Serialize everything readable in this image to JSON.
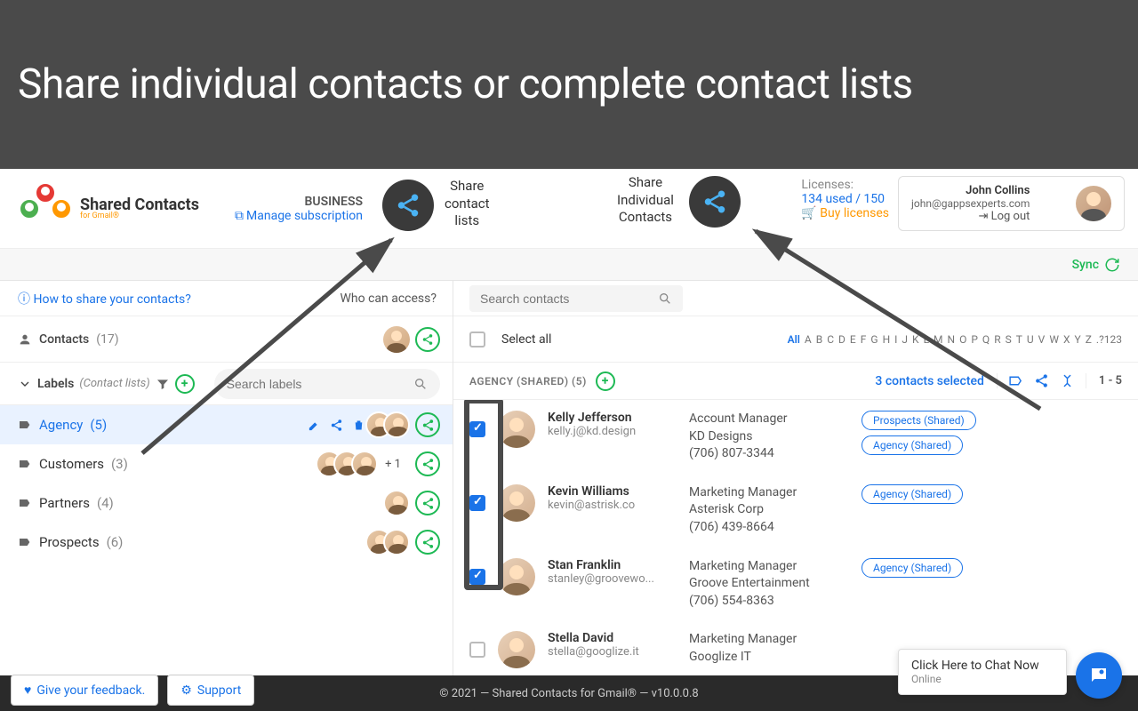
{
  "banner": {
    "title": "Share individual contacts or complete contact lists"
  },
  "logo": {
    "name": "Shared Contacts",
    "sub": "for Gmail®"
  },
  "plan": {
    "name": "BUSINESS",
    "manage": "Manage subscription"
  },
  "bubbles": {
    "lists": "Share\ncontact\nlists",
    "individual": "Share\nIndividual\nContacts"
  },
  "licenses": {
    "title": "Licenses:",
    "used": "134 used / 150",
    "buy": "Buy licenses"
  },
  "user": {
    "name": "John Collins",
    "email": "john@gappsexperts.com",
    "logout": "Log out"
  },
  "sync": "Sync",
  "sidebar": {
    "howto": "How to share your contacts?",
    "who": "Who can access?",
    "contacts": "Contacts",
    "contacts_count": "(17)",
    "labels_head": "Labels",
    "labels_sub": "(Contact lists)",
    "search_ph": "Search labels",
    "items": [
      {
        "name": "Agency",
        "count": "(5)",
        "active": true,
        "avatars": 2
      },
      {
        "name": "Customers",
        "count": "(3)",
        "active": false,
        "avatars": 3,
        "plus": "+ 1"
      },
      {
        "name": "Partners",
        "count": "(4)",
        "active": false,
        "avatars": 1
      },
      {
        "name": "Prospects",
        "count": "(6)",
        "active": false,
        "avatars": 2
      }
    ]
  },
  "content": {
    "search_ph": "Search contacts",
    "select_all": "Select all",
    "alpha_active": "All",
    "alpha": [
      "A",
      "B",
      "C",
      "D",
      "E",
      "F",
      "G",
      "H",
      "I",
      "J",
      "K",
      "L",
      "M",
      "N",
      "O",
      "P",
      "Q",
      "R",
      "S",
      "T",
      "U",
      "V",
      "W",
      "X",
      "Y",
      "Z",
      ".?123"
    ],
    "header_title": "AGENCY (SHARED) (5)",
    "selected": "3 contacts selected",
    "pager": "1 - 5",
    "rows": [
      {
        "name": "Kelly Jefferson",
        "email": "kelly.j@kd.design",
        "title": "Account Manager",
        "company": "KD Designs",
        "phone": "(706) 807-3344",
        "tags": [
          "Prospects (Shared)",
          "Agency (Shared)"
        ],
        "checked": true
      },
      {
        "name": "Kevin Williams",
        "email": "kevin@astrisk.co",
        "title": "Marketing Manager",
        "company": "Asterisk Corp",
        "phone": "(706) 439-8664",
        "tags": [
          "Agency (Shared)"
        ],
        "checked": true
      },
      {
        "name": "Stan Franklin",
        "email": "stanley@groovewo...",
        "title": "Marketing Manager",
        "company": "Groove Entertainment",
        "phone": "(706) 554-8363",
        "tags": [
          "Agency (Shared)"
        ],
        "checked": true
      },
      {
        "name": "Stella David",
        "email": "stella@googlize.it",
        "title": "Marketing Manager",
        "company": "Googlize IT",
        "phone": "",
        "tags": [],
        "checked": false
      }
    ]
  },
  "footer": {
    "copyright": "© 2021 — Shared Contacts for Gmail® — v10.0.0.8",
    "feedback": "Give your feedback.",
    "support": "Support"
  },
  "chat": {
    "title": "Click Here to Chat Now",
    "status": "Online"
  }
}
